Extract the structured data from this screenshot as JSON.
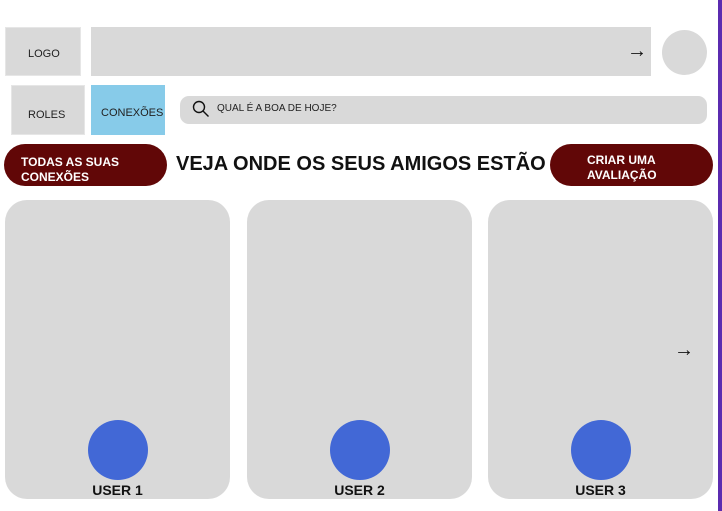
{
  "header": {
    "logo_label": "LOGO",
    "next_icon": "→"
  },
  "nav": {
    "roles_label": "ROLES",
    "conexoes_label": "CONEXÕES",
    "active_color": "#87cbe9"
  },
  "search": {
    "placeholder": "QUAL É A BOA DE HOJE?"
  },
  "actions": {
    "all_connections_line1": "TODAS AS SUAS",
    "all_connections_line2": "CONEXÕES",
    "create_review_line1": "CRIAR UMA",
    "create_review_line2": "AVALIAÇÃO",
    "button_color": "#610707"
  },
  "main": {
    "headline": "VEJA ONDE OS SEUS AMIGOS ESTÃO"
  },
  "users": [
    {
      "name": "USER 1"
    },
    {
      "name": "USER 2"
    },
    {
      "name": "USER 3"
    }
  ],
  "carousel": {
    "next_icon": "→"
  },
  "colors": {
    "avatar": "#4268d6",
    "placeholder_gray": "#d9d9d9"
  }
}
